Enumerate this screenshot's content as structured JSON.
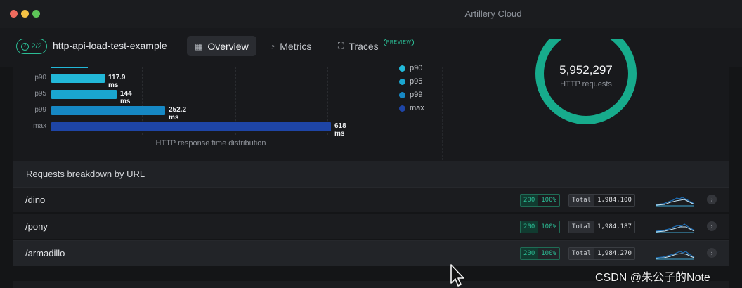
{
  "window": {
    "title": "Artillery Cloud"
  },
  "header": {
    "status_badge": "2/2",
    "test_name": "http-api-load-test-example",
    "tabs": [
      {
        "label": "Overview",
        "icon": "grid-icon",
        "active": true
      },
      {
        "label": "Metrics",
        "icon": "chart-icon",
        "active": false
      },
      {
        "label": "Traces",
        "icon": "scan-icon",
        "active": false,
        "badge": "PREVIEW"
      }
    ]
  },
  "chart_data": {
    "type": "bar",
    "orientation": "horizontal",
    "categories": [
      "p90",
      "p95",
      "p99",
      "max"
    ],
    "values": [
      117.9,
      144,
      252.2,
      618
    ],
    "value_labels": [
      "117.9 ms",
      "144 ms",
      "252.2 ms",
      "618 ms"
    ],
    "xlabel": "HTTP response time distribution",
    "legend": [
      "p90",
      "p95",
      "p99",
      "max"
    ],
    "legend_position": "right",
    "colors": [
      "#22b8d8",
      "#1aa6d0",
      "#1688c4",
      "#1e45a6"
    ]
  },
  "summary": {
    "total_requests": "5,952,297",
    "total_requests_label": "HTTP requests",
    "ring_color": "#17ab8c"
  },
  "breakdown": {
    "title": "Requests breakdown by URL",
    "rows": [
      {
        "url": "/dino",
        "status_code": "200",
        "percent": "100%",
        "total_label": "Total",
        "total": "1,984,100"
      },
      {
        "url": "/pony",
        "status_code": "200",
        "percent": "100%",
        "total_label": "Total",
        "total": "1,984,187"
      },
      {
        "url": "/armadillo",
        "status_code": "200",
        "percent": "100%",
        "total_label": "Total",
        "total": "1,984,270"
      }
    ]
  },
  "watermark": "CSDN @朱公子的Note"
}
